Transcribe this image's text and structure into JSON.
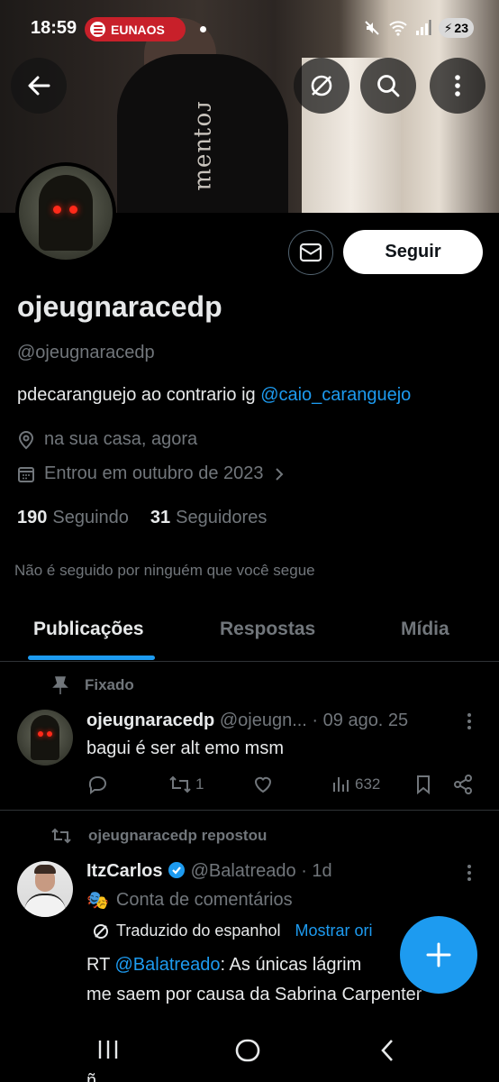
{
  "status_bar": {
    "time": "18:59",
    "media_pill": "EUNAOS",
    "battery": "23"
  },
  "profile": {
    "name": "ojeugnaracedp",
    "handle": "@ojeugnaracedp",
    "bio_text": "pdecaranguejo ao contrario ig ",
    "bio_link": "@caio_caranguejo",
    "location": "na sua casa, agora",
    "joined": "Entrou em outubro de 2023",
    "following_count": "190",
    "following_label": "Seguindo",
    "followers_count": "31",
    "followers_label": "Seguidores",
    "followed_by_note": "Não é seguido por ninguém que você segue",
    "banner_print": "ɾoʇuǝɯ"
  },
  "buttons": {
    "follow": "Seguir"
  },
  "tabs": [
    {
      "label": "Publicações"
    },
    {
      "label": "Respostas"
    },
    {
      "label": "Mídia"
    }
  ],
  "posts": [
    {
      "label": "Fixado",
      "author_name": "ojeugnaracedp",
      "author_handle": "@ojeugn...",
      "date": "· 09 ago. 25",
      "text": "bagui é ser alt emo msm",
      "reposts": "1",
      "views": "632"
    },
    {
      "label": "ojeugnaracedp repostou",
      "author_name": "ItzCarlos",
      "author_handle": "@Balatreado",
      "date": "· 1d",
      "account_label": "Conta de comentários",
      "translated_note": "Traduzido do espanhol",
      "show_original": "Mostrar ori",
      "text_prefix": "RT ",
      "mention": "@Balatreado",
      "text_line1": ": As únicas lágrim",
      "text_line2": "me saem por causa da Sabrina Carpenter",
      "text_peek": "ñ... ... ..."
    }
  ],
  "colors": {
    "accent": "#1d9bf0",
    "muted_text": "#71767b",
    "background": "#000000",
    "spotify_pill": "#c8202a"
  }
}
